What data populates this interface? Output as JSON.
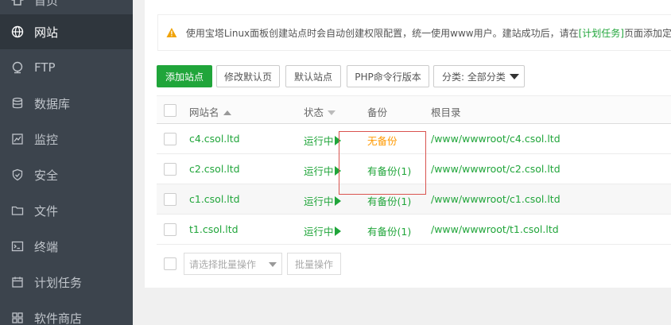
{
  "sidebar": {
    "items": [
      {
        "label": "首页",
        "icon": "home-icon"
      },
      {
        "label": "网站",
        "icon": "globe-icon",
        "active": true
      },
      {
        "label": "FTP",
        "icon": "ftp-icon"
      },
      {
        "label": "数据库",
        "icon": "database-icon"
      },
      {
        "label": "监控",
        "icon": "monitor-icon"
      },
      {
        "label": "安全",
        "icon": "shield-icon"
      },
      {
        "label": "文件",
        "icon": "folder-icon"
      },
      {
        "label": "终端",
        "icon": "terminal-icon"
      },
      {
        "label": "计划任务",
        "icon": "calendar-icon"
      },
      {
        "label": "软件商店",
        "icon": "store-icon"
      }
    ]
  },
  "notice": {
    "text_before": "使用宝塔Linux面板创建站点时会自动创建权限配置，统一使用www用户。建站成功后，请在",
    "link": "[计划任务]",
    "text_after": "页面添加定时"
  },
  "toolbar": {
    "add_site": "添加站点",
    "edit_default_page": "修改默认页",
    "default_site": "默认站点",
    "php_cli_version": "PHP命令行版本",
    "category_select": "分类: 全部分类"
  },
  "table": {
    "headers": {
      "name": "网站名",
      "status": "状态",
      "backup": "备份",
      "root": "根目录"
    },
    "rows": [
      {
        "name": "c4.csol.ltd",
        "status": "运行中",
        "backup": "无备份",
        "root": "/www/wwwroot/c4.csol.ltd"
      },
      {
        "name": "c2.csol.ltd",
        "status": "运行中",
        "backup": "有备份(1)",
        "root": "/www/wwwroot/c2.csol.ltd"
      },
      {
        "name": "c1.csol.ltd",
        "status": "运行中",
        "backup": "有备份(1)",
        "root": "/www/wwwroot/c1.csol.ltd"
      },
      {
        "name": "t1.csol.ltd",
        "status": "运行中",
        "backup": "有备份(1)",
        "root": "/www/wwwroot/t1.csol.ltd"
      }
    ]
  },
  "batch": {
    "placeholder": "请选择批量操作",
    "button": "批量操作"
  },
  "colors": {
    "accent": "#20a53a",
    "warning": "#ff9900",
    "sidebar_bg": "#3c444d",
    "highlight": "#d9534f"
  }
}
